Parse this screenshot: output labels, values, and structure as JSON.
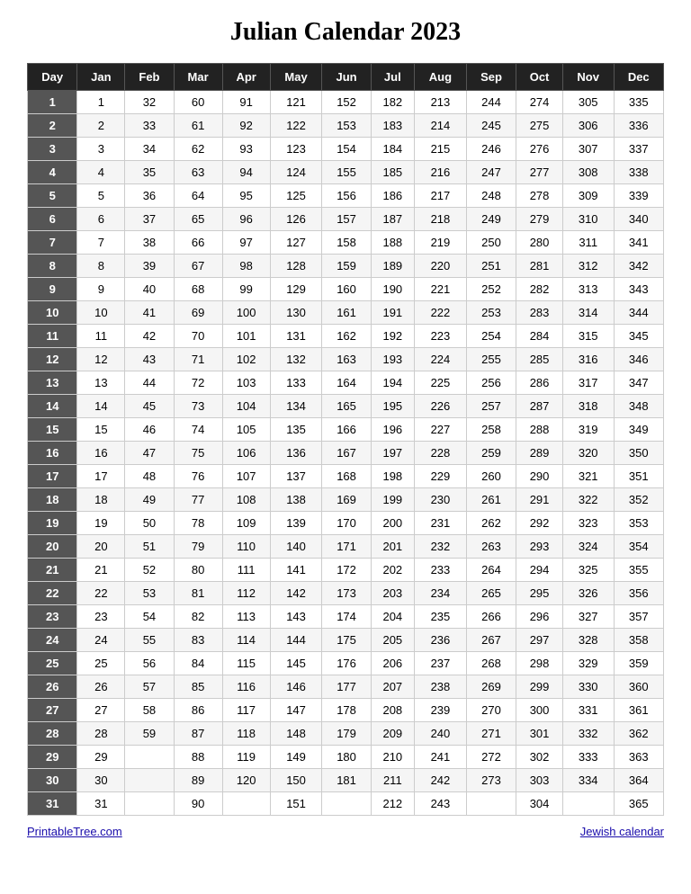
{
  "title": "Julian Calendar 2023",
  "headers": [
    "Day",
    "Jan",
    "Feb",
    "Mar",
    "Apr",
    "May",
    "Jun",
    "Jul",
    "Aug",
    "Sep",
    "Oct",
    "Nov",
    "Dec"
  ],
  "rows": [
    [
      "1",
      "1",
      "32",
      "60",
      "91",
      "121",
      "152",
      "182",
      "213",
      "244",
      "274",
      "305",
      "335"
    ],
    [
      "2",
      "2",
      "33",
      "61",
      "92",
      "122",
      "153",
      "183",
      "214",
      "245",
      "275",
      "306",
      "336"
    ],
    [
      "3",
      "3",
      "34",
      "62",
      "93",
      "123",
      "154",
      "184",
      "215",
      "246",
      "276",
      "307",
      "337"
    ],
    [
      "4",
      "4",
      "35",
      "63",
      "94",
      "124",
      "155",
      "185",
      "216",
      "247",
      "277",
      "308",
      "338"
    ],
    [
      "5",
      "5",
      "36",
      "64",
      "95",
      "125",
      "156",
      "186",
      "217",
      "248",
      "278",
      "309",
      "339"
    ],
    [
      "6",
      "6",
      "37",
      "65",
      "96",
      "126",
      "157",
      "187",
      "218",
      "249",
      "279",
      "310",
      "340"
    ],
    [
      "7",
      "7",
      "38",
      "66",
      "97",
      "127",
      "158",
      "188",
      "219",
      "250",
      "280",
      "311",
      "341"
    ],
    [
      "8",
      "8",
      "39",
      "67",
      "98",
      "128",
      "159",
      "189",
      "220",
      "251",
      "281",
      "312",
      "342"
    ],
    [
      "9",
      "9",
      "40",
      "68",
      "99",
      "129",
      "160",
      "190",
      "221",
      "252",
      "282",
      "313",
      "343"
    ],
    [
      "10",
      "10",
      "41",
      "69",
      "100",
      "130",
      "161",
      "191",
      "222",
      "253",
      "283",
      "314",
      "344"
    ],
    [
      "11",
      "11",
      "42",
      "70",
      "101",
      "131",
      "162",
      "192",
      "223",
      "254",
      "284",
      "315",
      "345"
    ],
    [
      "12",
      "12",
      "43",
      "71",
      "102",
      "132",
      "163",
      "193",
      "224",
      "255",
      "285",
      "316",
      "346"
    ],
    [
      "13",
      "13",
      "44",
      "72",
      "103",
      "133",
      "164",
      "194",
      "225",
      "256",
      "286",
      "317",
      "347"
    ],
    [
      "14",
      "14",
      "45",
      "73",
      "104",
      "134",
      "165",
      "195",
      "226",
      "257",
      "287",
      "318",
      "348"
    ],
    [
      "15",
      "15",
      "46",
      "74",
      "105",
      "135",
      "166",
      "196",
      "227",
      "258",
      "288",
      "319",
      "349"
    ],
    [
      "16",
      "16",
      "47",
      "75",
      "106",
      "136",
      "167",
      "197",
      "228",
      "259",
      "289",
      "320",
      "350"
    ],
    [
      "17",
      "17",
      "48",
      "76",
      "107",
      "137",
      "168",
      "198",
      "229",
      "260",
      "290",
      "321",
      "351"
    ],
    [
      "18",
      "18",
      "49",
      "77",
      "108",
      "138",
      "169",
      "199",
      "230",
      "261",
      "291",
      "322",
      "352"
    ],
    [
      "19",
      "19",
      "50",
      "78",
      "109",
      "139",
      "170",
      "200",
      "231",
      "262",
      "292",
      "323",
      "353"
    ],
    [
      "20",
      "20",
      "51",
      "79",
      "110",
      "140",
      "171",
      "201",
      "232",
      "263",
      "293",
      "324",
      "354"
    ],
    [
      "21",
      "21",
      "52",
      "80",
      "111",
      "141",
      "172",
      "202",
      "233",
      "264",
      "294",
      "325",
      "355"
    ],
    [
      "22",
      "22",
      "53",
      "81",
      "112",
      "142",
      "173",
      "203",
      "234",
      "265",
      "295",
      "326",
      "356"
    ],
    [
      "23",
      "23",
      "54",
      "82",
      "113",
      "143",
      "174",
      "204",
      "235",
      "266",
      "296",
      "327",
      "357"
    ],
    [
      "24",
      "24",
      "55",
      "83",
      "114",
      "144",
      "175",
      "205",
      "236",
      "267",
      "297",
      "328",
      "358"
    ],
    [
      "25",
      "25",
      "56",
      "84",
      "115",
      "145",
      "176",
      "206",
      "237",
      "268",
      "298",
      "329",
      "359"
    ],
    [
      "26",
      "26",
      "57",
      "85",
      "116",
      "146",
      "177",
      "207",
      "238",
      "269",
      "299",
      "330",
      "360"
    ],
    [
      "27",
      "27",
      "58",
      "86",
      "117",
      "147",
      "178",
      "208",
      "239",
      "270",
      "300",
      "331",
      "361"
    ],
    [
      "28",
      "28",
      "59",
      "87",
      "118",
      "148",
      "179",
      "209",
      "240",
      "271",
      "301",
      "332",
      "362"
    ],
    [
      "29",
      "29",
      "",
      "88",
      "119",
      "149",
      "180",
      "210",
      "241",
      "272",
      "302",
      "333",
      "363"
    ],
    [
      "30",
      "30",
      "",
      "89",
      "120",
      "150",
      "181",
      "211",
      "242",
      "273",
      "303",
      "334",
      "364"
    ],
    [
      "31",
      "31",
      "",
      "90",
      "",
      "151",
      "",
      "212",
      "243",
      "",
      "304",
      "",
      "365"
    ]
  ],
  "footer": {
    "left_text": "PrintableTree.com",
    "left_url": "https://printabletree.com",
    "right_text": "Jewish calendar",
    "right_url": "#"
  }
}
